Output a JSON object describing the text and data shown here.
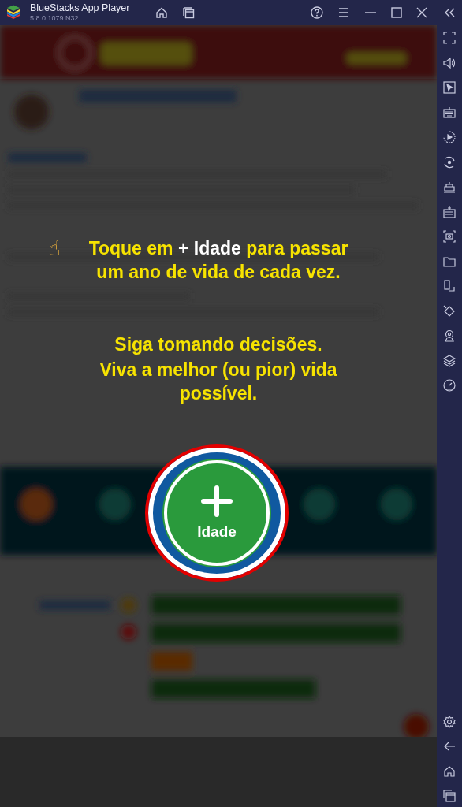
{
  "window": {
    "title": "BlueStacks App Player",
    "version": "5.8.0.1079  N32"
  },
  "tutorial": {
    "pointer": "☝",
    "lines": [
      {
        "parts": [
          {
            "text": "Toque em ",
            "highlight": false
          },
          {
            "text": "+ Idade",
            "highlight": true
          },
          {
            "text": " para passar um ano de vida de cada vez.",
            "highlight": false
          }
        ]
      },
      {
        "parts": [
          {
            "text": "Siga tomando decisões.",
            "highlight": false
          }
        ]
      },
      {
        "parts": [
          {
            "text": "Viva a melhor (ou pior) vida possível.",
            "highlight": false
          }
        ]
      }
    ]
  },
  "age_button": {
    "label": "Idade"
  }
}
